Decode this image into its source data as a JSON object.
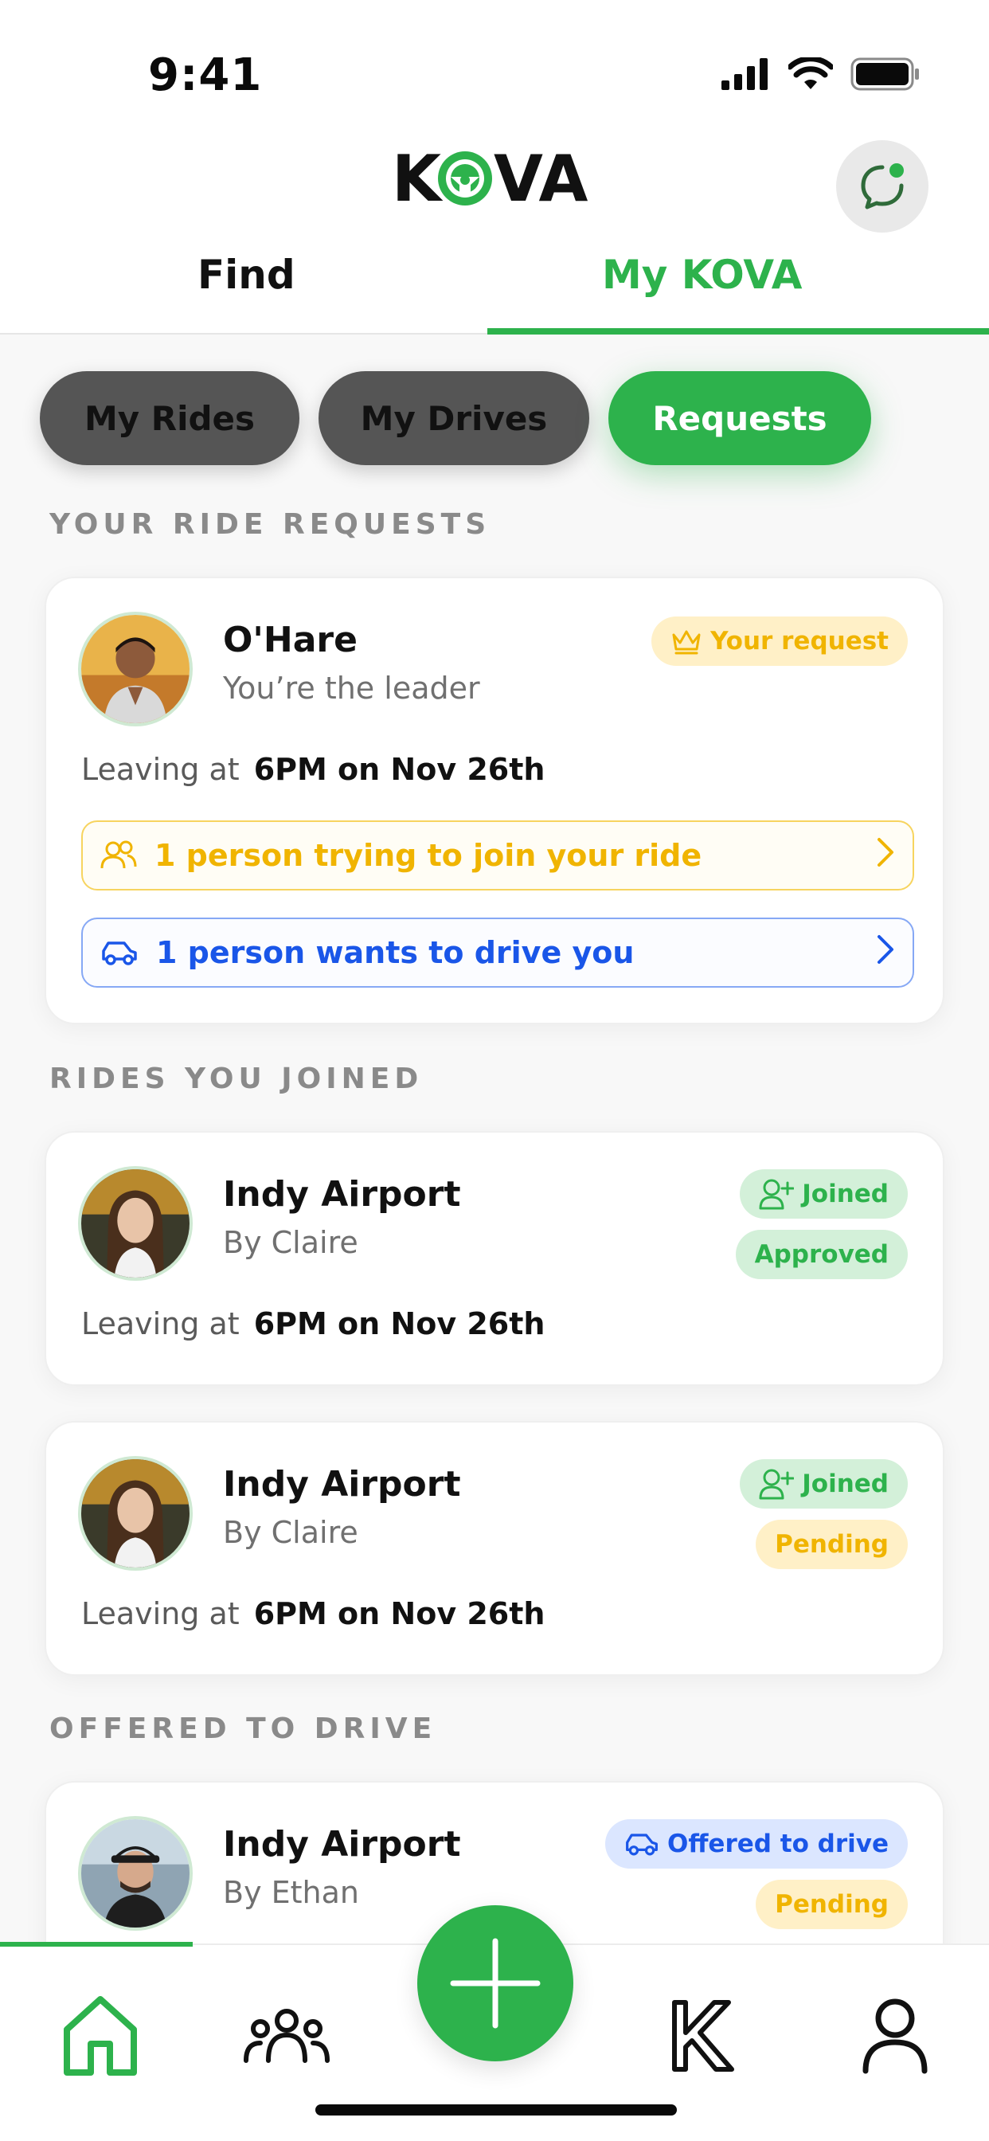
{
  "status_bar": {
    "time": "9:41"
  },
  "header": {
    "logo_text": "KOVA",
    "tabs": [
      {
        "label": "Find",
        "active": false
      },
      {
        "label": "My KOVA",
        "active": true
      }
    ]
  },
  "filters": [
    {
      "label": "My Rides",
      "active": false
    },
    {
      "label": "My Drives",
      "active": false
    },
    {
      "label": "Requests",
      "active": true
    }
  ],
  "sections": {
    "ride_requests": "YOUR RIDE REQUESTS",
    "rides_joined": "RIDES YOU JOINED",
    "offered_to_drive": "OFFERED TO DRIVE"
  },
  "request_card": {
    "destination": "O'Hare",
    "subtitle": "You’re the leader",
    "badge": "Your request",
    "leaving_label": "Leaving at",
    "leaving_time": "6PM on Nov 26th",
    "join_requests": "1 person trying to join your ride",
    "drive_offers": "1 person wants to drive you"
  },
  "joined_cards": [
    {
      "destination": "Indy Airport",
      "by": "By Claire",
      "badge_joined": "Joined",
      "status": "Approved",
      "leaving_label": "Leaving at",
      "leaving_time": "6PM on Nov 26th"
    },
    {
      "destination": "Indy Airport",
      "by": "By Claire",
      "badge_joined": "Joined",
      "status": "Pending",
      "leaving_label": "Leaving at",
      "leaving_time": "6PM on Nov 26th"
    }
  ],
  "offered_card": {
    "destination": "Indy Airport",
    "by": "By Ethan",
    "badge": "Offered to drive",
    "status": "Pending"
  },
  "colors": {
    "brand_green": "#2db24c",
    "yellow": "#f0b400",
    "blue": "#1a56e8",
    "pill_dark": "#555555"
  },
  "bottom_nav": [
    "home-icon",
    "community-icon",
    "add-icon",
    "kova-icon",
    "profile-icon"
  ]
}
